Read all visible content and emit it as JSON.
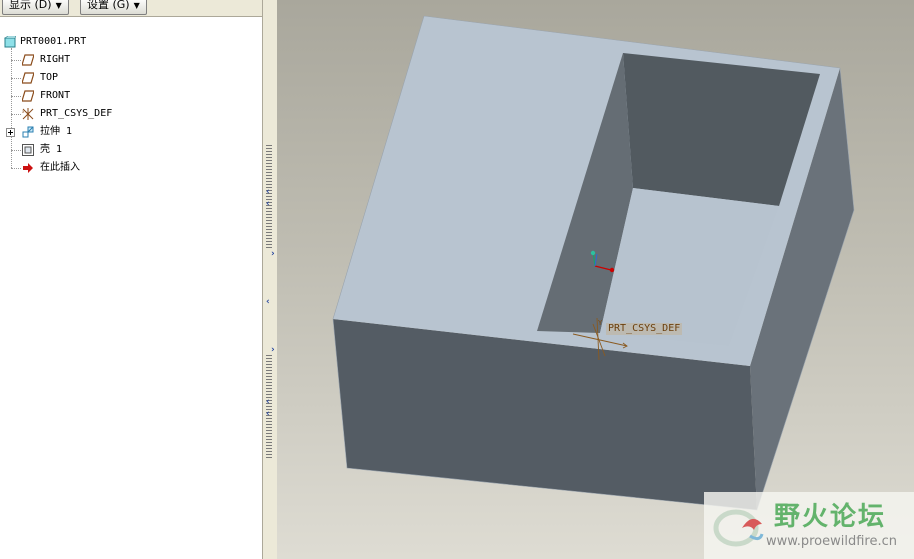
{
  "toolbar": {
    "show_label": "显示 (D)",
    "settings_label": "设置 (G)"
  },
  "tree": {
    "root": "PRT0001.PRT",
    "items": [
      {
        "label": "RIGHT",
        "icon": "datum-plane-icon"
      },
      {
        "label": "TOP",
        "icon": "datum-plane-icon"
      },
      {
        "label": "FRONT",
        "icon": "datum-plane-icon"
      },
      {
        "label": "PRT_CSYS_DEF",
        "icon": "coordinate-system-icon"
      },
      {
        "label": "拉伸 1",
        "icon": "extrude-icon"
      },
      {
        "label": "壳 1",
        "icon": "shell-icon"
      },
      {
        "label": "在此插入",
        "icon": "insert-here-arrow-icon"
      }
    ]
  },
  "viewport": {
    "csys_label": "PRT_CSYS_DEF"
  },
  "watermark": {
    "title": "野火论坛",
    "url": "www.proewildfire.cn"
  },
  "colors": {
    "top_face": "#b8c4d0",
    "front_face": "#545c64",
    "right_face": "#6a727a",
    "inner_wall": "#5a6268",
    "floor": "#b7c3cf",
    "accent_red": "#cc0000"
  }
}
